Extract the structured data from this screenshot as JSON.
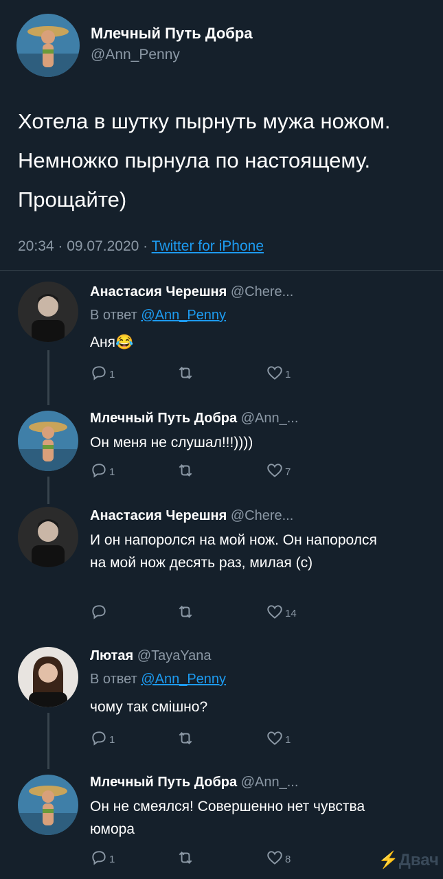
{
  "main_tweet": {
    "author_name": "Млечный Путь Добра",
    "author_handle": "@Ann_Penny",
    "text": "Хотела в шутку пырнуть мужа ножом. Немножко пырнула по настоящему. Прощайте)",
    "time": "20:34 · 09.07.2020 · ",
    "source": "Twitter for iPhone"
  },
  "replies": [
    {
      "author_name": "Анастасия Черешня",
      "author_handle": "@Chere...",
      "reply_prefix": "В ответ ",
      "reply_to": "@Ann_Penny",
      "text": "Аня😂",
      "reply_count": "1",
      "retweet_count": "",
      "like_count": "1"
    },
    {
      "author_name": "Млечный Путь Добра",
      "author_handle": "@Ann_...",
      "text": "Он меня не слушал!!!))))",
      "reply_count": "1",
      "retweet_count": "",
      "like_count": "7"
    },
    {
      "author_name": "Анастасия Черешня",
      "author_handle": "@Chere...",
      "text": "И он напоролся на мой нож. Он напоролся на мой нож десять раз, милая (с)",
      "reply_count": "",
      "retweet_count": "",
      "like_count": "14"
    },
    {
      "author_name": "Лютая",
      "author_handle": "@TayaYana",
      "reply_prefix": "В ответ ",
      "reply_to": "@Ann_Penny",
      "text": "чому так смішно?",
      "reply_count": "1",
      "retweet_count": "",
      "like_count": "1"
    },
    {
      "author_name": "Млечный Путь Добра",
      "author_handle": "@Ann_...",
      "text": "Он не смеялся! Совершенно нет чувства юмора",
      "reply_count": "1",
      "retweet_count": "",
      "like_count": "8"
    }
  ],
  "icons": {
    "reply": "reply-icon",
    "retweet": "retweet-icon",
    "like": "heart-icon"
  },
  "colors": {
    "background": "#15202b",
    "text": "#ffffff",
    "secondary": "#8b98a5",
    "link": "#1d9bf0"
  },
  "watermark": "⚡Двач"
}
